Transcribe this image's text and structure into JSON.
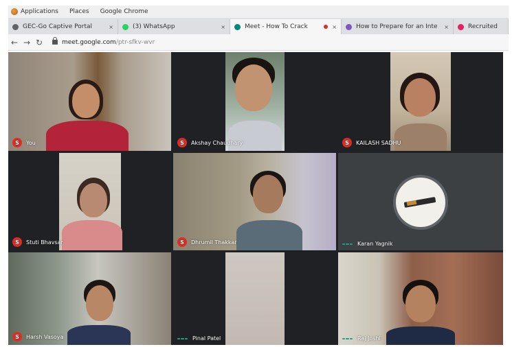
{
  "os_bar": {
    "items": [
      "Applications",
      "Places",
      "Google Chrome"
    ]
  },
  "tabs": [
    {
      "label": "GEC-Go Captive Portal",
      "favicon_color": "#5f6368",
      "active": false
    },
    {
      "label": "(3) WhatsApp",
      "favicon_color": "#25d366",
      "active": false
    },
    {
      "label": "Meet - How To Crack",
      "favicon_color": "#00897b",
      "active": true,
      "recording": true
    },
    {
      "label": "How to Prepare for an Inte",
      "favicon_color": "#7e57c2",
      "active": false
    },
    {
      "label": "Recruited",
      "favicon_color": "#e91e63",
      "active": false
    }
  ],
  "tab_close_glyph": "×",
  "address_bar": {
    "host": "meet.google.com",
    "path": "/ptr-sfkv-wvr",
    "back_glyph": "←",
    "forward_glyph": "→",
    "reload_glyph": "↻"
  },
  "participants": [
    {
      "name": "You",
      "status": "muted"
    },
    {
      "name": "Akshay Chaudhary",
      "status": "muted"
    },
    {
      "name": "KAILASH SADHU",
      "status": "muted"
    },
    {
      "name": "Stuti Bhavsar",
      "status": "muted"
    },
    {
      "name": "Dhrumil Thakkar",
      "status": "muted"
    },
    {
      "name": "Karan Yagnik",
      "status": "speaking"
    },
    {
      "name": "Harsh Vasoya",
      "status": "muted"
    },
    {
      "name": "Pinal Patel",
      "status": "speaking"
    },
    {
      "name": "Raj Joshi",
      "status": "speaking"
    }
  ],
  "badge_letter": "S",
  "colors": {
    "meet_background": "#202124",
    "muted_badge": "#d93025",
    "speaking_indicator": "#1aa38a"
  }
}
